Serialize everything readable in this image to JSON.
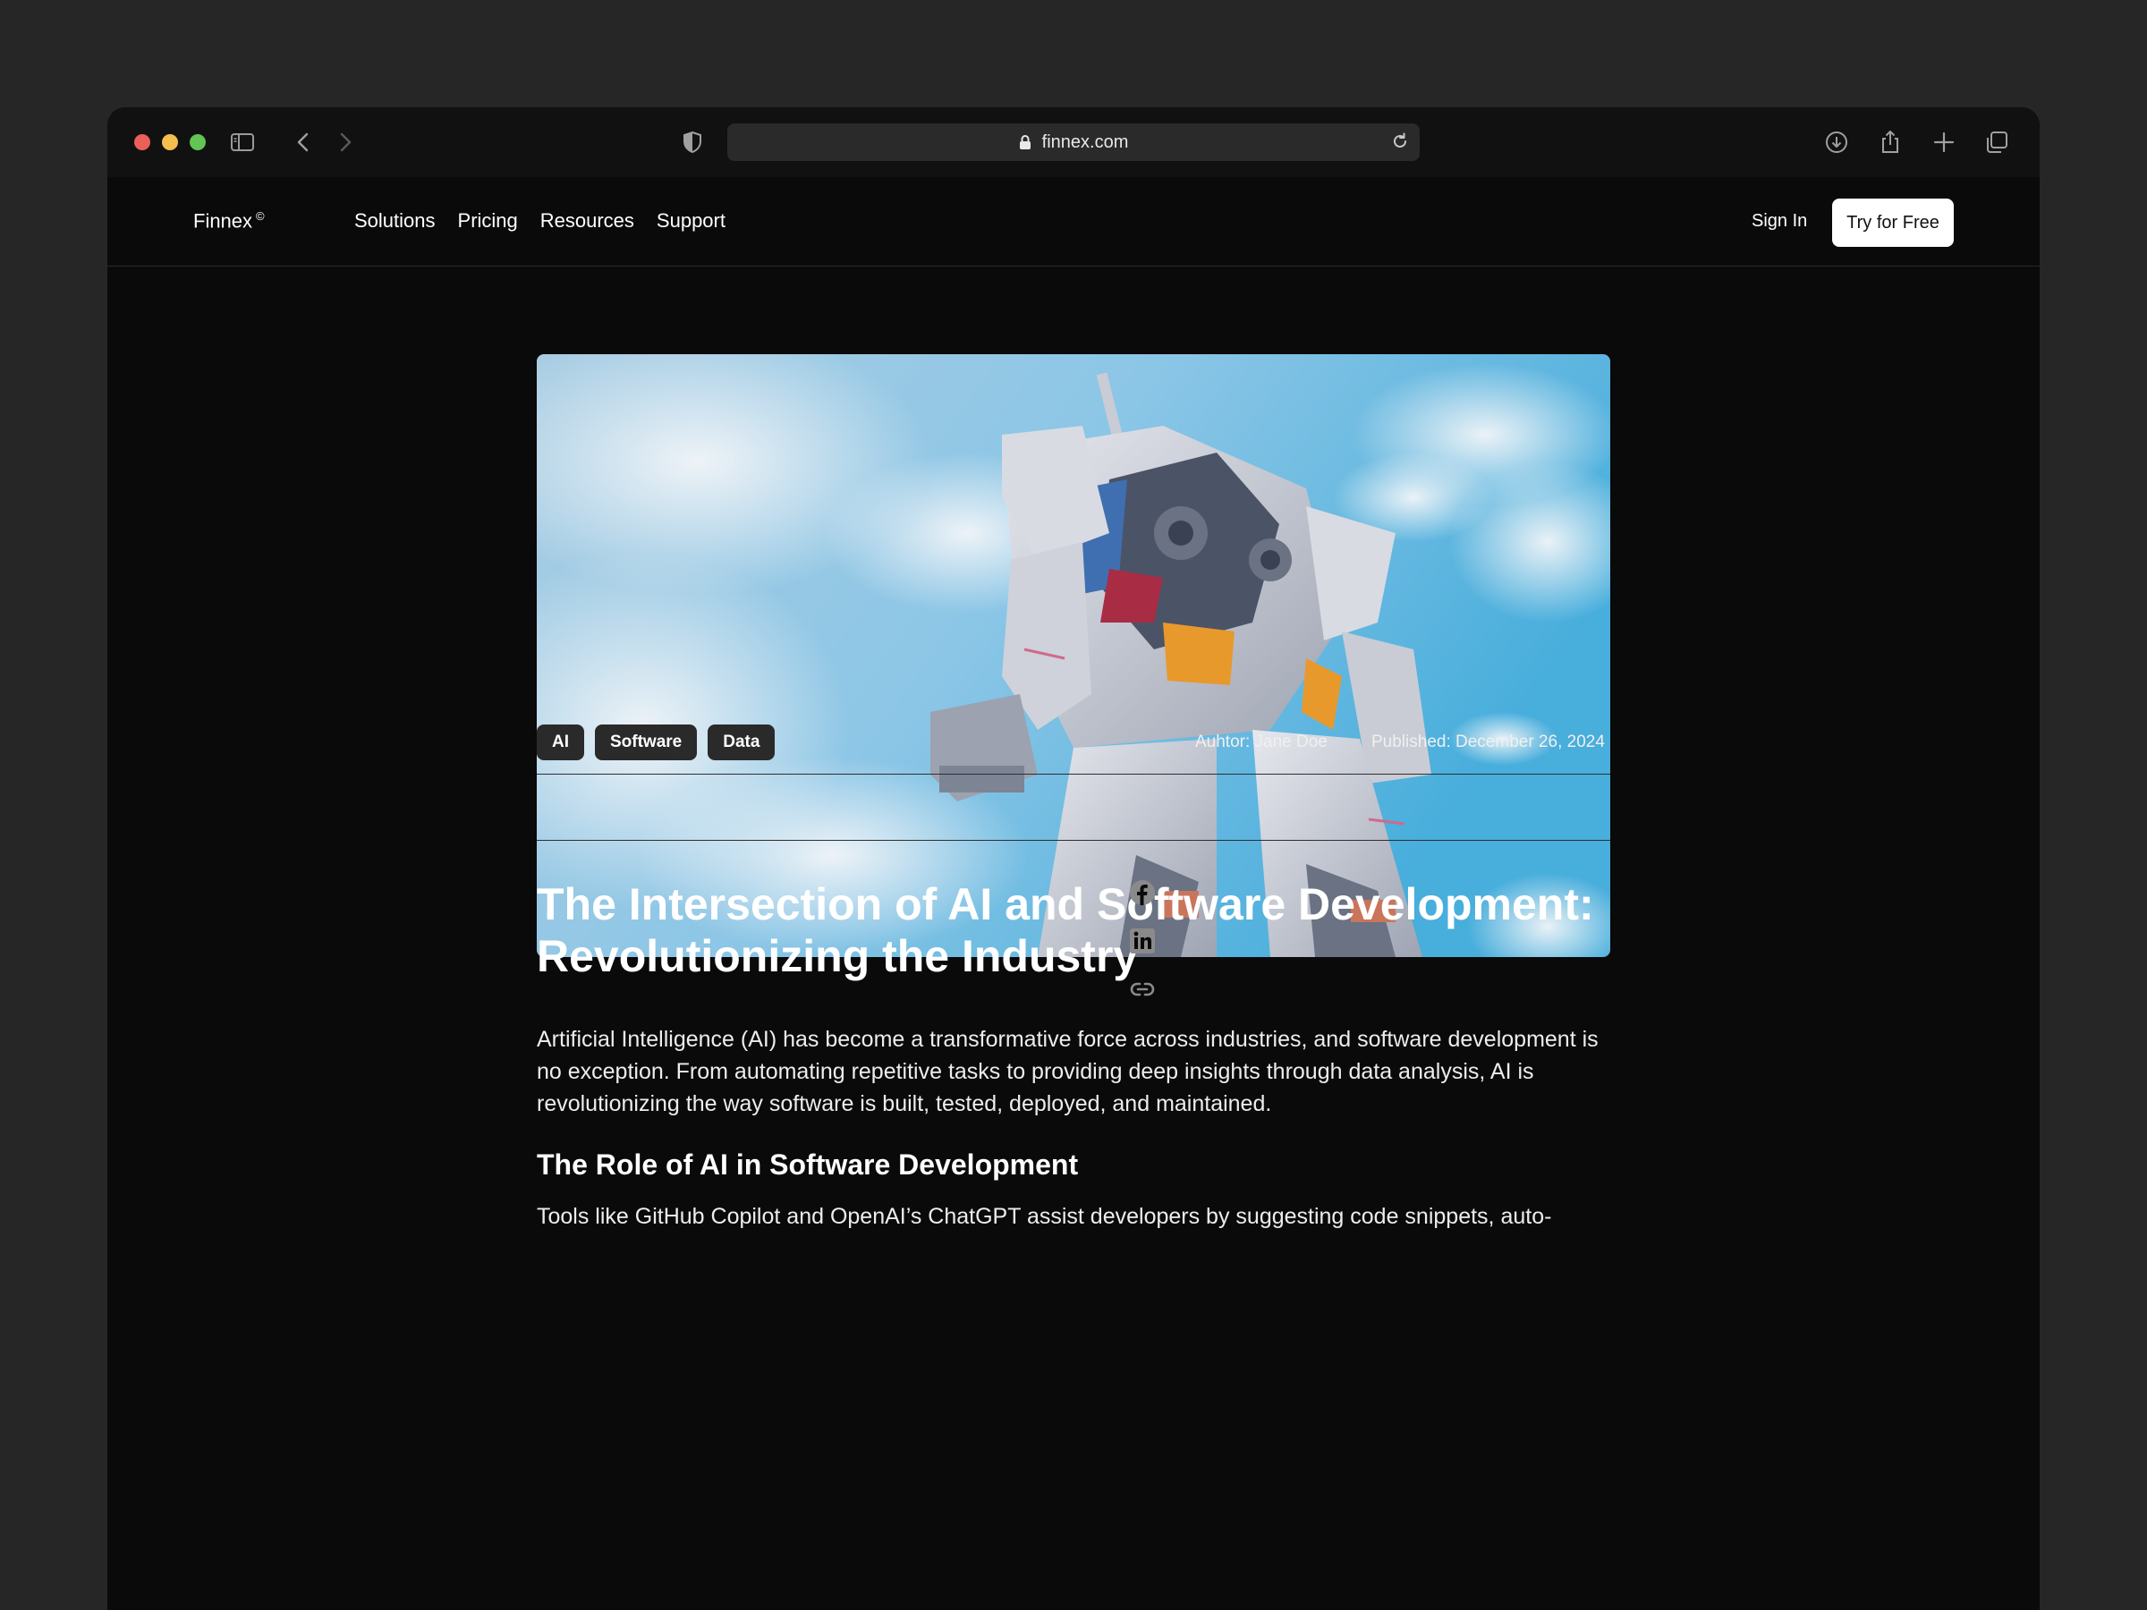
{
  "browser": {
    "url": "finnex.com",
    "icons": [
      "sidebar-icon",
      "back-icon",
      "forward-icon",
      "shield-icon",
      "lock-icon",
      "reload-icon",
      "download-icon",
      "share-icon",
      "new-tab-icon",
      "tabs-overview-icon"
    ]
  },
  "nav": {
    "logo": "Finnex",
    "logo_mark": "©",
    "links": [
      "Solutions",
      "Pricing",
      "Resources",
      "Support"
    ],
    "sign_in": "Sign In",
    "cta": "Try for Free"
  },
  "article": {
    "hero_image": "robot-sky-photo",
    "tags": [
      "AI",
      "Software",
      "Data"
    ],
    "author": "Auhtor: Jane Doe",
    "published": "Published: December 26, 2024",
    "title_line1": "The Intersection of AI and Software Development:",
    "title_line2": "Revolutionizing the Industry",
    "lead": "Artificial Intelligence (AI) has become a transformative force across industries, and software development is no exception. From automating repetitive tasks to providing deep insights through data analysis, AI is revolutionizing the way software is built, tested, deployed, and maintained.",
    "section_heading": "The Role of AI in Software Development",
    "section_text": "Tools like GitHub Copilot and OpenAI’s ChatGPT assist developers by suggesting code snippets, auto-",
    "share_icons": [
      "facebook-icon",
      "linkedin-icon",
      "link-icon"
    ]
  },
  "colors": {
    "page_bg": "#0a0a0a",
    "outer_bg": "#262626",
    "tag_bg": "#2a2a2a",
    "sky": "#5bb8e0"
  }
}
